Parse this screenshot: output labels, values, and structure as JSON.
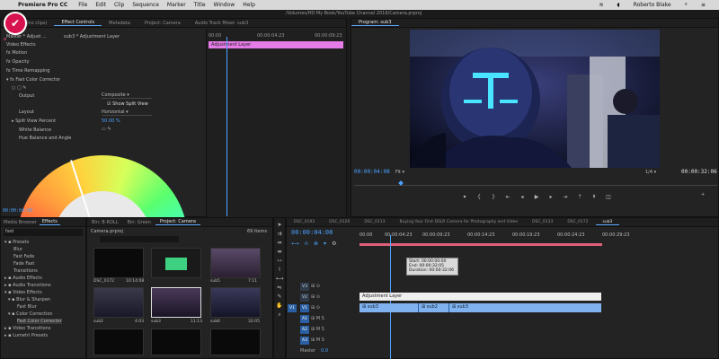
{
  "menubar": {
    "app": "Premiere Pro CC",
    "items": [
      "File",
      "Edit",
      "Clip",
      "Sequence",
      "Marker",
      "Title",
      "Window",
      "Help"
    ],
    "user": "Roberto Blake"
  },
  "window_path": "/Volumes/HD My Book/YouTube Channel 2016/Camera.prproj",
  "effect_controls": {
    "tabs": [
      "Source: (no clips)",
      "Effect Controls",
      "Metadata",
      "Project: Camera",
      "Audio Track Mixer: sub3"
    ],
    "master": "Master * Adjust ...",
    "sequence": "sub3 * Adjustment Layer",
    "video_effects": "Video Effects",
    "motion": "Motion",
    "opacity": "Opacity",
    "time_remap": "Time Remapping",
    "fast_color": "Fast Color Corrector",
    "output_label": "Output",
    "output_value": "Composite",
    "show_split": "Show Split View",
    "layout_label": "Layout",
    "layout_value": "Horizontal",
    "split_label": "Split View Percent",
    "split_value": "50.00 %",
    "white_balance": "White Balance",
    "hue_balance": "Hue Balance and Angle",
    "ruler_start": "00:00",
    "ruler_mid": "00:00:04:23",
    "ruler_end": "00:00:09:23",
    "clip_label": "Adjustment Layer",
    "bottom_tc": "00:00:04:08"
  },
  "program": {
    "title": "Program: sub3",
    "timecode": "00:00:04:08",
    "fit": "Fit",
    "fraction": "1/4",
    "duration": "00:00:32:06"
  },
  "effects_panel": {
    "tabs": [
      "Media Browser",
      "Effects"
    ],
    "search": "fast",
    "items": [
      "Presets",
      "Blur",
      "Fast Fade",
      "Fade Fast",
      "Transitions",
      "Audio Effects",
      "Audio Transitions",
      "Video Effects",
      "Blur & Sharpen",
      "Fast Blur",
      "Color Correction",
      "Fast Color Corrector",
      "Video Transitions",
      "Lumetri Presets"
    ]
  },
  "project": {
    "tabs": [
      "Bin: B-ROLL",
      "Bin: Green",
      "Project: Camera"
    ],
    "file": "Camera.prproj",
    "count": "69 Items",
    "clips": [
      {
        "name": "DSC_0172",
        "dur": "10:14:08"
      },
      {
        "name": "",
        "dur": ""
      },
      {
        "name": "sub5",
        "dur": "7:11"
      },
      {
        "name": "sub2",
        "dur": "4:03"
      },
      {
        "name": "sub3",
        "dur": "11:13"
      },
      {
        "name": "sub6",
        "dur": "32:05"
      }
    ]
  },
  "timeline": {
    "tabs": [
      "DSC_0193",
      "DSC_0120",
      "DSC_0113",
      "Buying Your First DSLR Camera for Photography and Video",
      "DSC_0133",
      "DSC_0172",
      "sub3"
    ],
    "timecode": "00:00:04:08",
    "ruler": [
      "00:00",
      "00:00:04:23",
      "00:00:09:23",
      "00:00:14:23",
      "00:00:19:23",
      "00:00:24:23",
      "00:00:29:23"
    ],
    "tooltip": [
      "Start: 00:00:00:00",
      "End: 00:00:32:05",
      "Duration: 00:00:32:06"
    ],
    "tracks": [
      "V3",
      "V2",
      "V1",
      "A1",
      "A2",
      "A3",
      "Master"
    ],
    "master_val": "0.0",
    "adj_clip": "Adjustment Layer",
    "clips": [
      "sub3",
      "sub2",
      "sub3"
    ]
  },
  "colors": {
    "accent": "#4aa3ff",
    "clip_pink": "#e57be6",
    "clip_blue": "#7fb2ee",
    "logo": "#d8124e"
  }
}
